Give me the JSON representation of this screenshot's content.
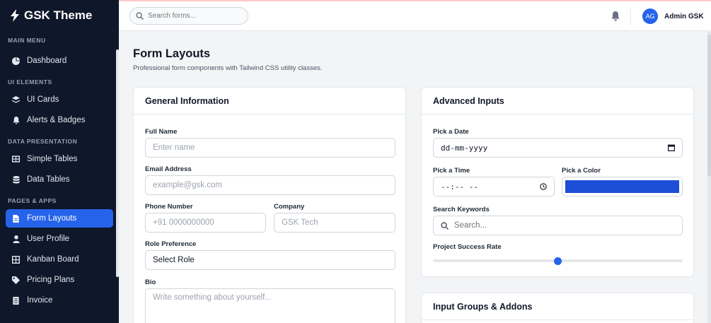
{
  "brand": {
    "title": "GSK Theme"
  },
  "sidebar": {
    "sections": [
      {
        "label": "MAIN MENU",
        "items": [
          {
            "label": "Dashboard",
            "icon": "pie-chart-icon"
          }
        ]
      },
      {
        "label": "UI ELEMENTS",
        "items": [
          {
            "label": "UI Cards",
            "icon": "layers-icon"
          },
          {
            "label": "Alerts & Badges",
            "icon": "bell-icon"
          }
        ]
      },
      {
        "label": "DATA PRESENTATION",
        "items": [
          {
            "label": "Simple Tables",
            "icon": "table-icon"
          },
          {
            "label": "Data Tables",
            "icon": "database-icon"
          }
        ]
      },
      {
        "label": "PAGES & APPS",
        "items": [
          {
            "label": "Form Layouts",
            "icon": "file-icon",
            "active": true
          },
          {
            "label": "User Profile",
            "icon": "user-icon"
          },
          {
            "label": "Kanban Board",
            "icon": "kanban-icon"
          },
          {
            "label": "Pricing Plans",
            "icon": "tag-icon"
          },
          {
            "label": "Invoice",
            "icon": "receipt-icon"
          }
        ]
      }
    ]
  },
  "topbar": {
    "search_placeholder": "Search forms...",
    "avatar_initials": "AG",
    "username": "Admin GSK"
  },
  "page": {
    "title": "Form Layouts",
    "subtitle": "Professional form components with Tailwind CSS utility classes."
  },
  "general": {
    "title": "General Information",
    "full_name_label": "Full Name",
    "full_name_placeholder": "Enter name",
    "email_label": "Email Address",
    "email_placeholder": "example@gsk.com",
    "phone_label": "Phone Number",
    "phone_placeholder": "+91 0000000000",
    "company_label": "Company",
    "company_placeholder": "GSK Tech",
    "role_label": "Role Preference",
    "role_value": "Select Role",
    "bio_label": "Bio",
    "bio_placeholder": "Write something about yourself..."
  },
  "advanced": {
    "title": "Advanced Inputs",
    "date_label": "Pick a Date",
    "date_value": "dd-mm-yyyy",
    "time_label": "Pick a Time",
    "time_value": "--:-- --",
    "color_label": "Pick a Color",
    "color_value": "#1d4ed8",
    "keywords_label": "Search Keywords",
    "keywords_placeholder": "Search...",
    "success_label": "Project Success Rate",
    "success_rate": 50
  },
  "groups": {
    "title": "Input Groups & Addons"
  },
  "colors": {
    "sidebar_bg": "#0f172a",
    "accent": "#2563eb"
  }
}
